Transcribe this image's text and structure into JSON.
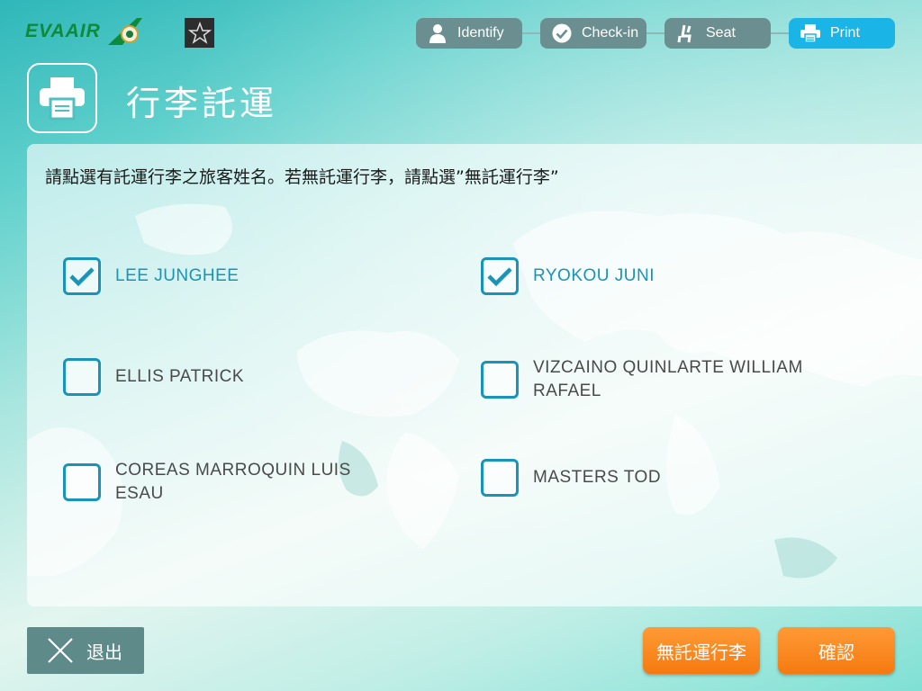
{
  "brand": {
    "name": "EVAAIR"
  },
  "steps": [
    {
      "label": "Identify",
      "icon": "person-icon",
      "active": false
    },
    {
      "label": "Check-in",
      "icon": "check-circle-icon",
      "active": false
    },
    {
      "label": "Seat",
      "icon": "seat-icon",
      "active": false
    },
    {
      "label": "Print",
      "icon": "printer-icon",
      "active": true
    }
  ],
  "page": {
    "title": "行李託運",
    "instruction": "請點選有託運行李之旅客姓名。若無託運行李，請點選”無託運行李”"
  },
  "passengers": [
    {
      "name": "LEE JUNGHEE",
      "checked": true
    },
    {
      "name": "RYOKOU JUNI",
      "checked": true
    },
    {
      "name": "ELLIS PATRICK",
      "checked": false
    },
    {
      "name": "VIZCAINO QUINLARTE WILLIAM RAFAEL",
      "checked": false
    },
    {
      "name": "COREAS MARROQUIN LUIS ESAU",
      "checked": false
    },
    {
      "name": "MASTERS TOD",
      "checked": false
    }
  ],
  "footer": {
    "exit_label": "退出",
    "no_baggage_label": "無託運行李",
    "confirm_label": "確認"
  },
  "colors": {
    "accent_blue": "#1a93b8",
    "step_active": "#1ab4e6",
    "step_inactive": "#6b8f91",
    "button_orange": "#f57a10",
    "brand_green": "#0d8a3c"
  }
}
